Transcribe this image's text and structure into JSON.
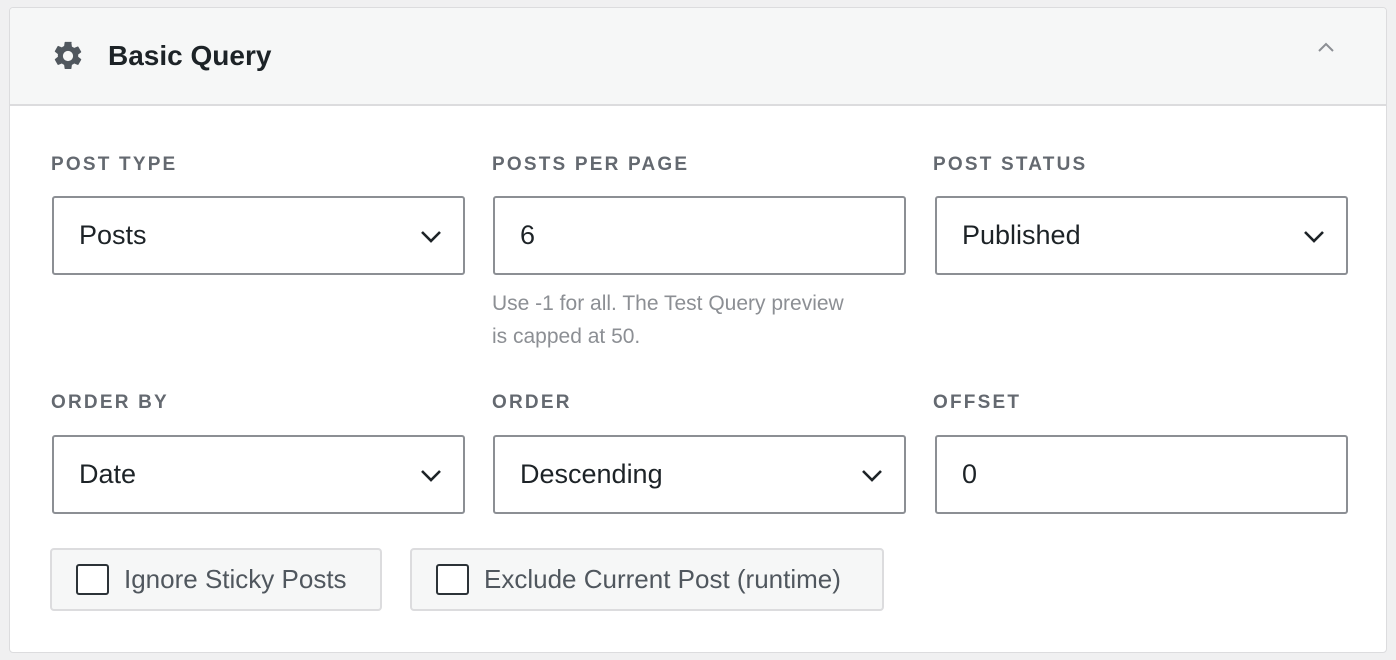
{
  "panel": {
    "title": "Basic Query",
    "icon": "gear-icon",
    "collapse_icon": "chevron-up-icon"
  },
  "fields": {
    "post_type": {
      "label": "POST TYPE",
      "value": "Posts"
    },
    "posts_per_page": {
      "label": "POSTS PER PAGE",
      "value": "6",
      "help_line1": "Use -1 for all. The Test Query preview",
      "help_line2": "is capped at 50."
    },
    "post_status": {
      "label": "POST STATUS",
      "value": "Published"
    },
    "order_by": {
      "label": "ORDER BY",
      "value": "Date"
    },
    "order": {
      "label": "ORDER",
      "value": "Descending"
    },
    "offset": {
      "label": "OFFSET",
      "value": "0"
    }
  },
  "options": {
    "ignore_sticky": {
      "label": "Ignore Sticky Posts",
      "checked": false
    },
    "exclude_current": {
      "label": "Exclude Current Post (runtime)",
      "checked": false
    }
  },
  "colors": {
    "label": "#646970",
    "border": "#8c8f94",
    "header_bg": "#f6f7f7",
    "help_text": "#8c8f94"
  }
}
